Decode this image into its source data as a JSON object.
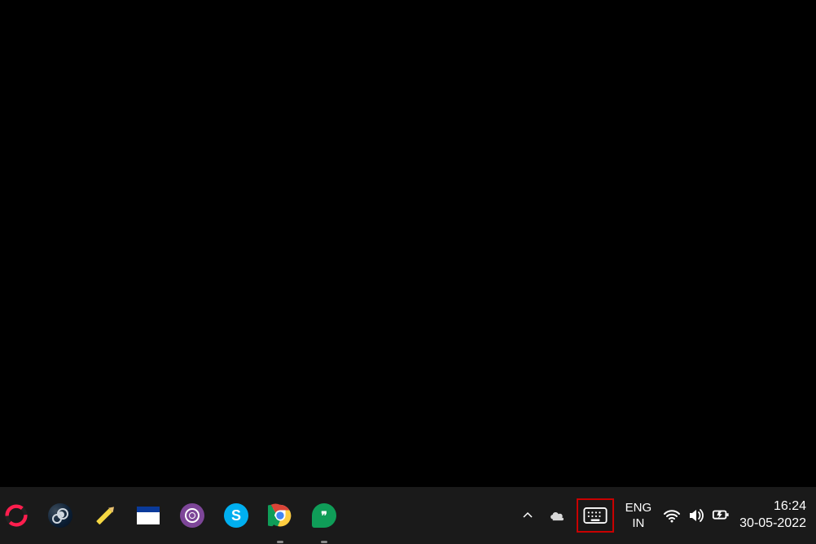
{
  "taskbar": {
    "apps": [
      {
        "name": "opera-gx-icon"
      },
      {
        "name": "steam-icon"
      },
      {
        "name": "pencil-app-icon"
      },
      {
        "name": "window-app-icon"
      },
      {
        "name": "tor-browser-icon"
      },
      {
        "name": "skype-icon",
        "letter": "S"
      },
      {
        "name": "chrome-icon",
        "running": true
      },
      {
        "name": "hangouts-icon",
        "glyph": "❞",
        "running": true
      }
    ]
  },
  "tray": {
    "onedrive": "cloud-icon"
  },
  "language": {
    "lang": "ENG",
    "region": "IN"
  },
  "datetime": {
    "time": "16:24",
    "date": "30-05-2022"
  }
}
